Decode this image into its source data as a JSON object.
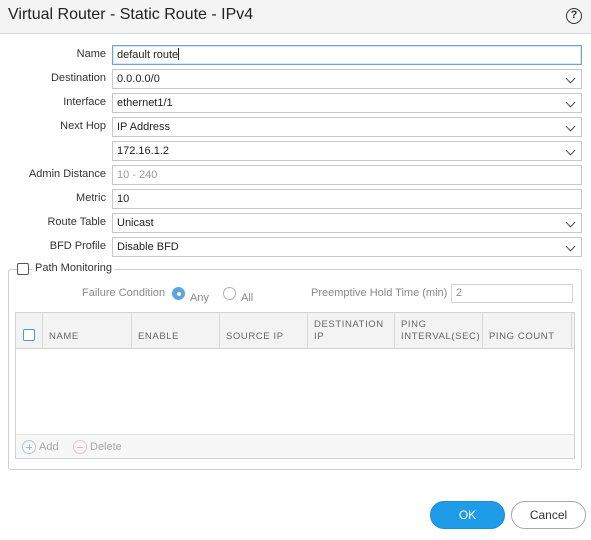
{
  "dialog": {
    "title": "Virtual Router - Static Route - IPv4"
  },
  "form": {
    "name": {
      "label": "Name",
      "value": "default route"
    },
    "destination": {
      "label": "Destination",
      "value": "0.0.0.0/0"
    },
    "interface": {
      "label": "Interface",
      "value": "ethernet1/1"
    },
    "next_hop": {
      "label": "Next Hop",
      "type": "IP Address",
      "address": "172.16.1.2"
    },
    "admin_distance": {
      "label": "Admin Distance",
      "placeholder": "10 - 240"
    },
    "metric": {
      "label": "Metric",
      "value": "10"
    },
    "route_table": {
      "label": "Route Table",
      "value": "Unicast"
    },
    "bfd_profile": {
      "label": "BFD Profile",
      "value": "Disable BFD"
    }
  },
  "path_monitoring": {
    "label": "Path Monitoring",
    "failure_condition_label": "Failure Condition",
    "any_label": "Any",
    "all_label": "All",
    "preemptive_hold_label": "Preemptive Hold Time (min)",
    "preemptive_hold_value": "2",
    "table": {
      "columns": [
        "NAME",
        "ENABLE",
        "SOURCE IP",
        "DESTINATION IP",
        "PING INTERVAL(SEC)",
        "PING COUNT"
      ]
    },
    "add_label": "Add",
    "delete_label": "Delete"
  },
  "buttons": {
    "ok": "OK",
    "cancel": "Cancel"
  },
  "colors": {
    "primary": "#1e9ce8",
    "radio_selected": "#5aa7e0"
  }
}
